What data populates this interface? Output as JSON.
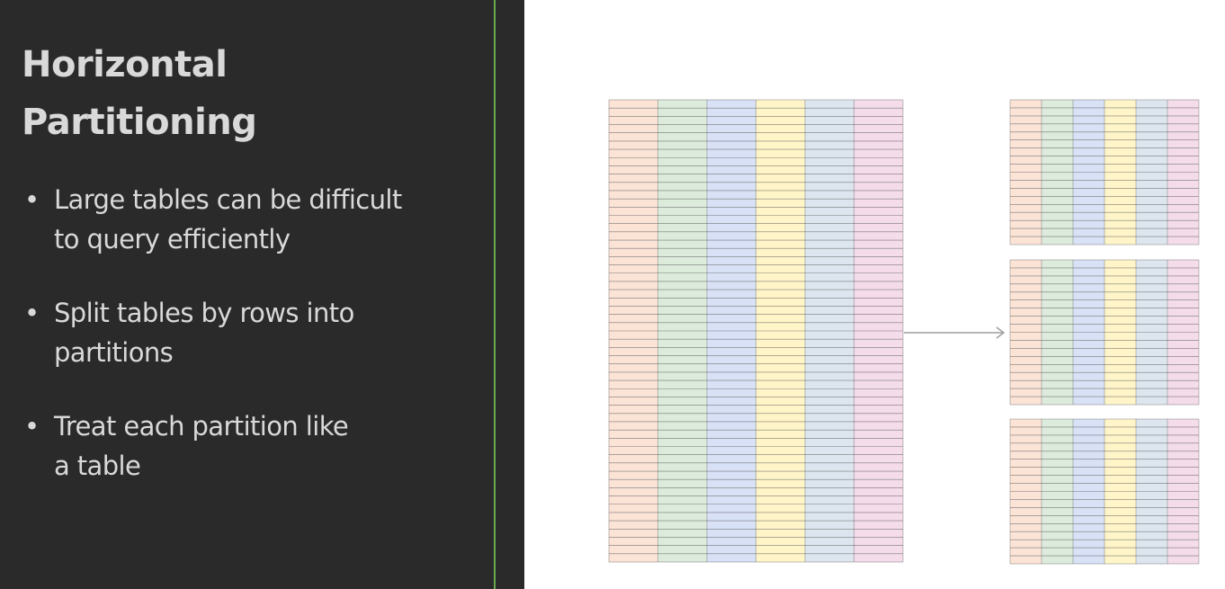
{
  "slide": {
    "title_lines": [
      "Horizontal",
      "Partitioning"
    ],
    "bullets": [
      {
        "lines": [
          "Large tables can be difficult",
          "to query efficiently"
        ]
      },
      {
        "lines": [
          "Split tables by rows into",
          "partitions"
        ]
      },
      {
        "lines": [
          "Treat each partition like",
          "a table"
        ]
      }
    ],
    "bullet_glyph": "•"
  },
  "colors": {
    "panel_background": "#2a2a2a",
    "panel_text": "#d9d9d9",
    "accent_line": "#6aa84f",
    "row_line": "#555555",
    "arrow": "#9e9e9e",
    "column_tints": [
      "#fbe3d6",
      "#dcebdc",
      "#d8e1f6",
      "#fff5c9",
      "#dde6ee",
      "#f4dcea"
    ]
  },
  "diagram": {
    "column_count": 6,
    "source_table_rows": 56,
    "partitions": [
      {
        "rows": 18
      },
      {
        "rows": 18
      },
      {
        "rows": 18
      }
    ],
    "icons": [
      "arrow-right-icon"
    ]
  }
}
